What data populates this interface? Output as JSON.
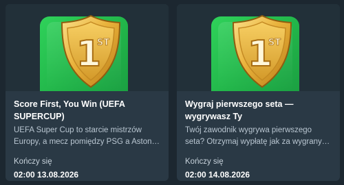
{
  "cards": [
    {
      "title": "Score First, You Win (UEFA SUPERCUP)",
      "description": "UEFA Super Cup to starcie mistrzów Europy, a mecz pomiędzy PSG a Aston…",
      "ends_label": "Kończy się",
      "ends_at": "02:00 13.08.2026",
      "badge_text": "1",
      "badge_suffix": "ST",
      "badge_icon": "gold-first-place-shield-icon"
    },
    {
      "title": "Wygraj pierwszego seta — wygrywasz Ty",
      "description": "Twój zawodnik wygrywa pierwszego seta? Otrzymaj wypłatę jak za wygrany…",
      "ends_label": "Kończy się",
      "ends_at": "02:00 14.08.2026",
      "badge_text": "1",
      "badge_suffix": "ST",
      "badge_icon": "gold-first-place-shield-icon"
    }
  ],
  "colors": {
    "page_bg": "#1c2730",
    "card_bg": "#2a3945",
    "tile_green": "#27c24f",
    "gold": "#f2c24a"
  }
}
